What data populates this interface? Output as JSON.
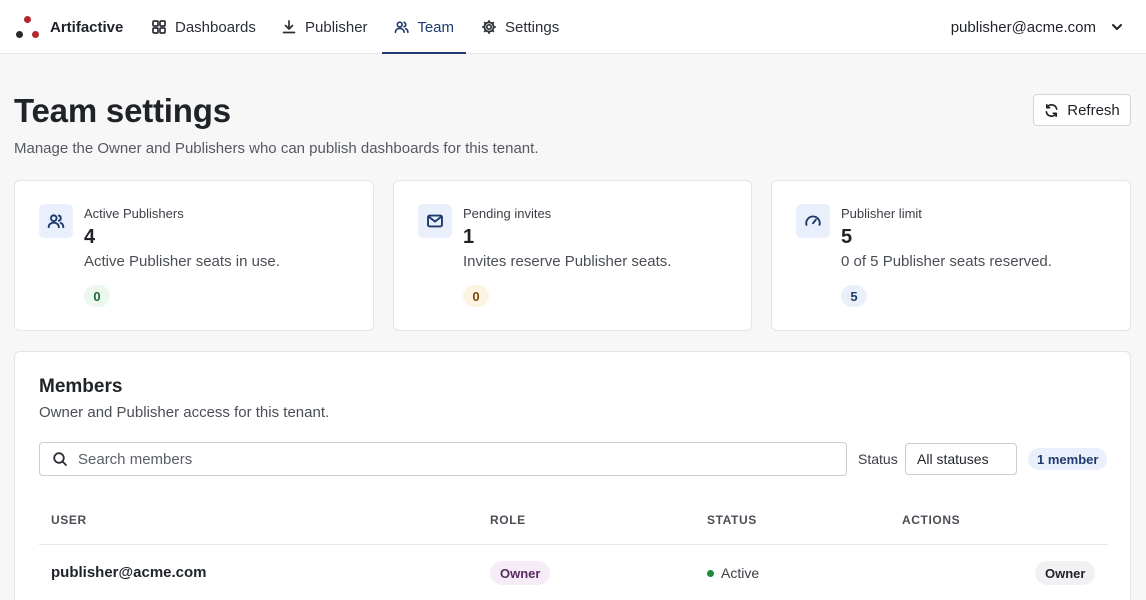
{
  "brand": {
    "name": "Artifactive"
  },
  "nav": {
    "tabs": [
      {
        "label": "Dashboards",
        "icon": "dashboard-grid-icon"
      },
      {
        "label": "Publisher",
        "icon": "download-icon"
      },
      {
        "label": "Team",
        "icon": "users-icon",
        "active": true
      },
      {
        "label": "Settings",
        "icon": "gear-icon"
      }
    ],
    "user_email": "publisher@acme.com"
  },
  "header": {
    "title": "Team settings",
    "subtitle": "Manage the Owner and Publishers who can publish dashboards for this tenant.",
    "refresh_label": "Refresh"
  },
  "stats": [
    {
      "label": "Active Publishers",
      "value": "4",
      "description": "Active Publisher seats in use.",
      "pill": "0",
      "icon": "users-icon",
      "pill_color": "#ecf8ee"
    },
    {
      "label": "Pending invites",
      "value": "1",
      "description": "Invites reserve Publisher seats.",
      "pill": "0",
      "icon": "mail-icon",
      "pill_color": "#fdf3e3"
    },
    {
      "label": "Publisher limit",
      "value": "5",
      "description": "0 of 5 Publisher seats reserved.",
      "pill": "5",
      "icon": "gauge-icon",
      "pill_color": "#eaf0fb"
    }
  ],
  "members": {
    "title": "Members",
    "subtitle": "Owner and Publisher access for this tenant.",
    "search_placeholder": "Search members",
    "status_label": "Status",
    "status_selected": "All statuses",
    "count_label": "1 member",
    "columns": [
      "USER",
      "ROLE",
      "STATUS",
      "ACTIONS"
    ],
    "rows": [
      {
        "user": "publisher@acme.com",
        "role": "Owner",
        "status": "Active",
        "action": "Owner"
      }
    ]
  },
  "colors": {
    "accent": "#1f3a6d",
    "brand_red": "#b3282d",
    "status_active": "#1f8a3c"
  }
}
